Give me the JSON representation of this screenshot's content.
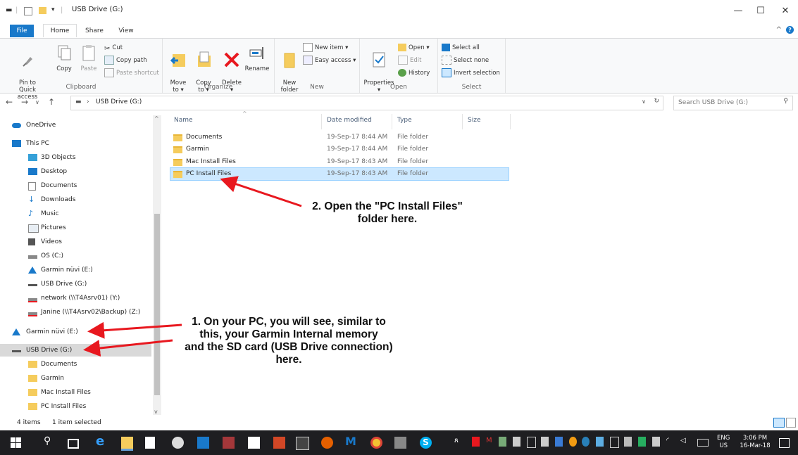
{
  "window": {
    "title": "USB Drive (G:)"
  },
  "tabs": {
    "file": "File",
    "home": "Home",
    "share": "Share",
    "view": "View"
  },
  "ribbon": {
    "clipboard": {
      "label": "Clipboard",
      "pin": "Pin to Quick\naccess",
      "copy": "Copy",
      "paste": "Paste",
      "cut": "Cut",
      "copy_path": "Copy path",
      "paste_shortcut": "Paste shortcut"
    },
    "organize": {
      "label": "Organize",
      "move_to": "Move\nto ▾",
      "copy_to": "Copy\nto ▾",
      "delete": "Delete\n▾",
      "rename": "Rename"
    },
    "new": {
      "label": "New",
      "new_folder": "New\nfolder",
      "new_item": "New item ▾",
      "easy_access": "Easy access ▾"
    },
    "open": {
      "label": "Open",
      "properties": "Properties\n▾",
      "open": "Open ▾",
      "edit": "Edit",
      "history": "History"
    },
    "select": {
      "label": "Select",
      "select_all": "Select all",
      "select_none": "Select none",
      "invert": "Invert selection"
    }
  },
  "address": {
    "path": "USB Drive (G:)",
    "search_placeholder": "Search USB Drive (G:)"
  },
  "nav": {
    "items": [
      {
        "label": "OneDrive",
        "icon": "cloud-icon"
      },
      {
        "label": "This PC",
        "icon": "pc-icon"
      },
      {
        "label": "3D Objects",
        "icon": "cube-icon"
      },
      {
        "label": "Desktop",
        "icon": "desktop-icon"
      },
      {
        "label": "Documents",
        "icon": "document-icon"
      },
      {
        "label": "Downloads",
        "icon": "download-icon"
      },
      {
        "label": "Music",
        "icon": "music-icon"
      },
      {
        "label": "Pictures",
        "icon": "pictures-icon"
      },
      {
        "label": "Videos",
        "icon": "videos-icon"
      },
      {
        "label": "OS (C:)",
        "icon": "os-drive-icon"
      },
      {
        "label": "Garmin nüvi (E:)",
        "icon": "garmin-drive-icon"
      },
      {
        "label": "USB Drive (G:)",
        "icon": "usb-drive-icon"
      },
      {
        "label": "network (\\\\T4Asrv01) (Y:)",
        "icon": "network-drive-icon"
      },
      {
        "label": "Janine (\\\\T4Asrv02\\Backup) (Z:)",
        "icon": "network-drive-icon"
      },
      {
        "label": "Garmin nüvi (E:)",
        "icon": "garmin-drive-icon"
      },
      {
        "label": "USB Drive (G:)",
        "icon": "usb-drive-icon"
      },
      {
        "label": "Documents",
        "icon": "folder-icon"
      },
      {
        "label": "Garmin",
        "icon": "folder-icon"
      },
      {
        "label": "Mac Install Files",
        "icon": "folder-icon"
      },
      {
        "label": "PC Install Files",
        "icon": "folder-icon"
      }
    ]
  },
  "files": {
    "columns": {
      "name": "Name",
      "date": "Date modified",
      "type": "Type",
      "size": "Size"
    },
    "rows": [
      {
        "name": "Documents",
        "date": "19-Sep-17 8:44 AM",
        "type": "File folder"
      },
      {
        "name": "Garmin",
        "date": "19-Sep-17 8:44 AM",
        "type": "File folder"
      },
      {
        "name": "Mac Install Files",
        "date": "19-Sep-17 8:43 AM",
        "type": "File folder"
      },
      {
        "name": "PC Install Files",
        "date": "19-Sep-17 8:43 AM",
        "type": "File folder"
      }
    ]
  },
  "annotations": {
    "step2": "2. Open the \"PC Install Files\"\nfolder here.",
    "step1": "1. On your PC, you will see, similar to\nthis, your Garmin Internal memory\nand the SD card (USB Drive connection)\nhere."
  },
  "status": {
    "items": "4 items",
    "selected": "1 item selected"
  },
  "taskbar": {
    "lang": "ENG",
    "region": "US",
    "time": "3:06 PM",
    "date": "16-Mar-18"
  },
  "colors": {
    "accent": "#1979ca",
    "selection": "#cce8ff",
    "arrow": "#e8181f",
    "taskbar": "#1e1e21"
  }
}
